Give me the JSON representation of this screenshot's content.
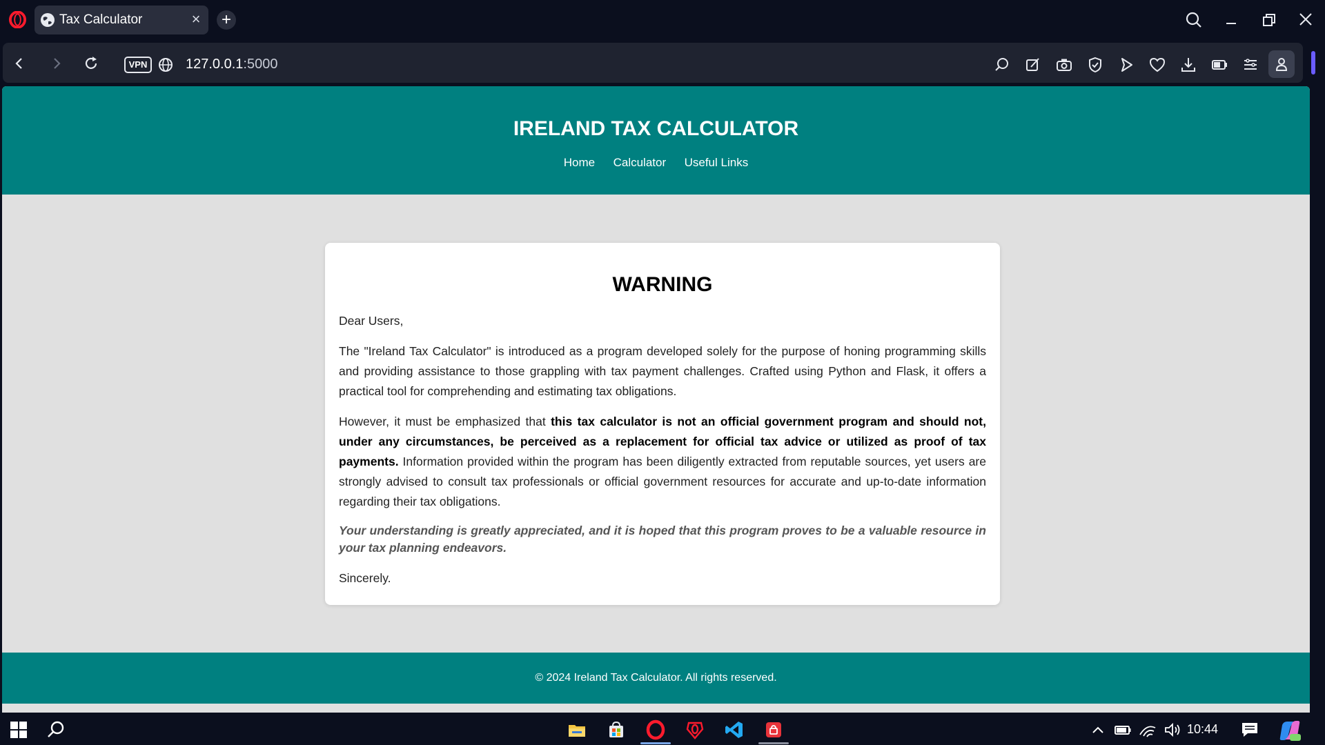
{
  "browser": {
    "tab_title": "Tax Calculator",
    "vpn_label": "VPN",
    "url_host": "127.0.0.1",
    "url_port": ":5000"
  },
  "site": {
    "title": "IRELAND TAX CALCULATOR",
    "nav": [
      "Home",
      "Calculator",
      "Useful Links"
    ]
  },
  "warning": {
    "heading": "WARNING",
    "greeting": "Dear Users,",
    "para1": "The \"Ireland Tax Calculator\" is introduced as a program developed solely for the purpose of honing programming skills and providing assistance to those grappling with tax payment challenges. Crafted using Python and Flask, it offers a practical tool for comprehending and estimating tax obligations.",
    "para2_lead": "However, it must be emphasized that ",
    "para2_bold": "this tax calculator is not an official government program and should not, under any circumstances, be perceived as a replacement for official tax advice or utilized as proof of tax payments.",
    "para2_tail": " Information provided within the program has been diligently extracted from reputable sources, yet users are strongly advised to consult tax professionals or official government resources for accurate and up-to-date information regarding their tax obligations.",
    "appreciation": "Your understanding is greatly appreciated, and it is hoped that this program proves to be a valuable resource in your tax planning endeavors.",
    "closing": "Sincerely."
  },
  "footer": {
    "text": "© 2024 Ireland Tax Calculator. All rights reserved."
  },
  "taskbar": {
    "time": "10:44"
  },
  "colors": {
    "header_teal": "#008080",
    "page_bg": "#e0e0e0",
    "chrome_bg": "#0b0f1e",
    "opera_red": "#ff1b2d"
  }
}
